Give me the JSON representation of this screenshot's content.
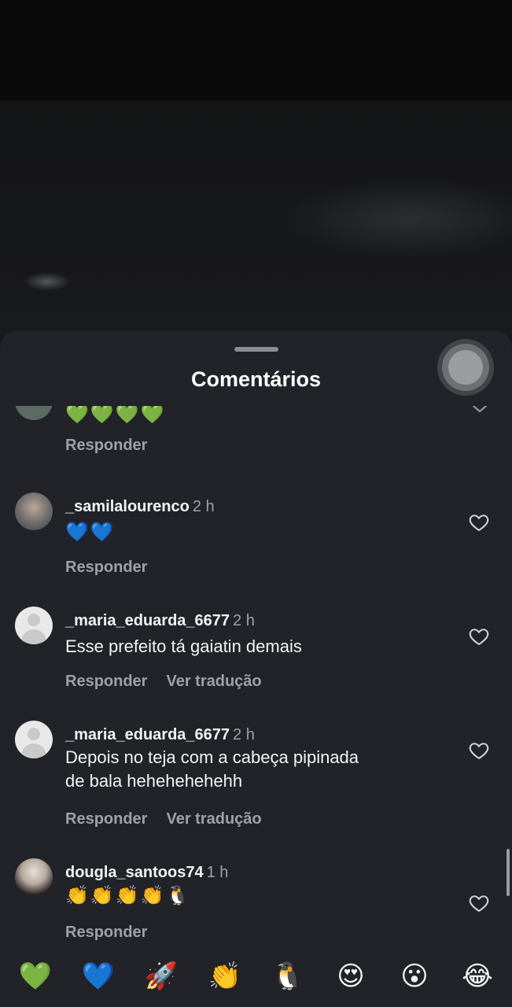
{
  "sheet": {
    "title": "Comentários"
  },
  "comments": [
    {
      "username": "",
      "time": "",
      "text": "💚💚💚💚",
      "reply_label": "Responder"
    },
    {
      "username": "_samilalourenco",
      "time": "2 h",
      "text": "💙💙",
      "reply_label": "Responder"
    },
    {
      "username": "_maria_eduarda_6677",
      "time": "2 h",
      "text": "Esse prefeito tá gaiatin demais",
      "reply_label": "Responder",
      "translate_label": "Ver tradução"
    },
    {
      "username": "_maria_eduarda_6677",
      "time": "2 h",
      "text_line1": "Depois no teja com a cabeça pipinada",
      "text_line2": "de bala hehehehehehh",
      "reply_label": "Responder",
      "translate_label": "Ver tradução"
    },
    {
      "username": "dougla_santoos74",
      "time": "1 h",
      "text": "👏👏👏👏🐧",
      "reply_label": "Responder"
    }
  ],
  "quick_reactions": [
    "💚",
    "💙",
    "🚀",
    "👏",
    "🐧",
    "😍",
    "😮",
    "😂"
  ],
  "icons": {
    "like": "heart-outline-icon",
    "collapse": "chevron-down-icon"
  }
}
